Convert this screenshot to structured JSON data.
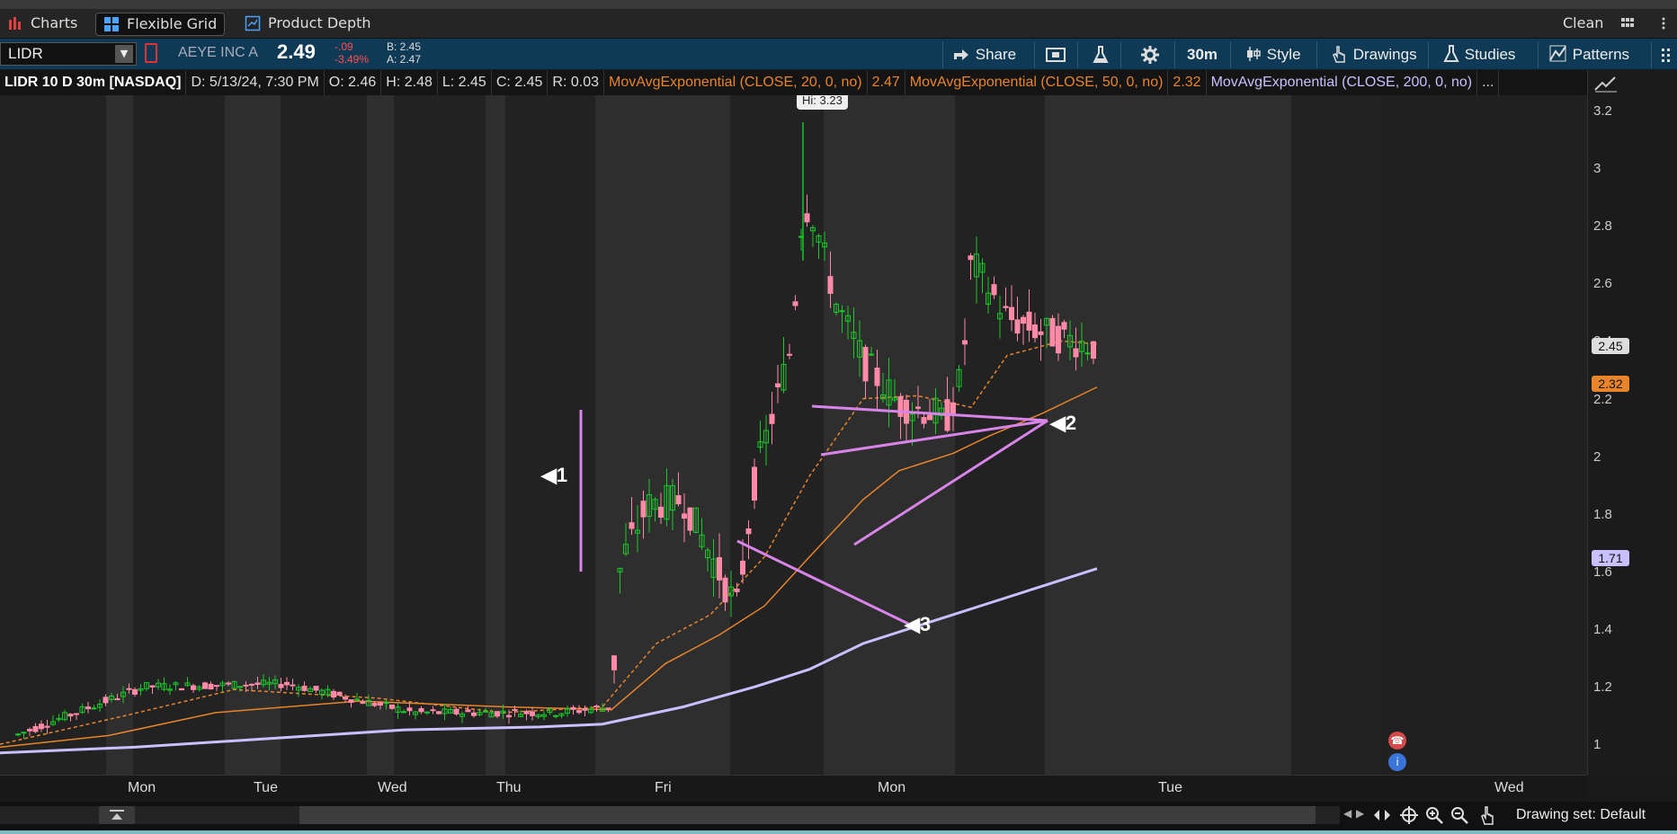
{
  "tabs": {
    "charts": "Charts",
    "flexible_grid": "Flexible Grid",
    "product_depth": "Product Depth",
    "clean": "Clean"
  },
  "quote": {
    "symbol": "LIDR",
    "company": "AEYE INC A",
    "last": "2.49",
    "change": "-.09",
    "change_pct": "-3.49%",
    "bid": "B: 2.45",
    "ask": "A: 2.47"
  },
  "toolbar": {
    "share": "Share",
    "interval": "30m",
    "style": "Style",
    "drawings": "Drawings",
    "studies": "Studies",
    "patterns": "Patterns"
  },
  "info": {
    "title": "LIDR 10 D 30m [NASDAQ]",
    "date": "D: 5/13/24, 7:30 PM",
    "open": "O: 2.46",
    "high": "H: 2.48",
    "low": "L: 2.45",
    "close": "C: 2.45",
    "range": "R: 0.03",
    "ema20_label": "MovAvgExponential (CLOSE, 20, 0, no)",
    "ema20_value": "2.47",
    "ema50_label": "MovAvgExponential (CLOSE, 50, 0, no)",
    "ema50_value": "2.32",
    "ema200_label": "MovAvgExponential (CLOSE, 200, 0, no)",
    "more": "..."
  },
  "chart": {
    "hi_label": "Hi: 3.23",
    "last_price_tag": "2.45",
    "ema50_tag": "2.32",
    "ema200_tag": "1.71",
    "y_ticks": [
      "3.2",
      "3",
      "2.8",
      "2.6",
      "2.4",
      "2.2",
      "2",
      "1.8",
      "1.6",
      "1.4",
      "1.2",
      "1"
    ],
    "x_ticks": [
      "Mon",
      "Tue",
      "Wed",
      "Thu",
      "Fri",
      "Mon",
      "Tue",
      "Wed"
    ],
    "markers": [
      "1",
      "2",
      "3"
    ]
  },
  "bottom": {
    "drawing_set": "Drawing set: Default"
  },
  "colors": {
    "up": "#19c82a",
    "down": "#ff8aa8",
    "ema20": "#e8842b",
    "ema50": "#e8842b",
    "ema200": "#c8c0ff",
    "drawing": "#d884e8",
    "quote_bg": "#0f3a55"
  }
}
